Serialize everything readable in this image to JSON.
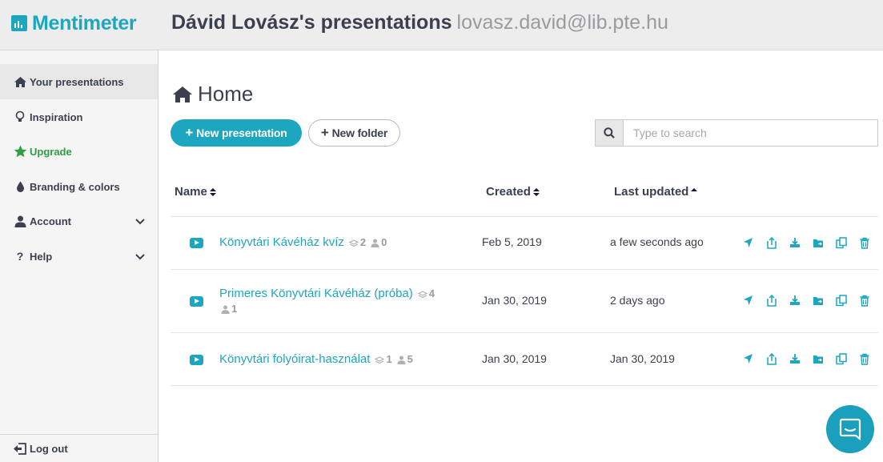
{
  "header": {
    "brand": "Mentimeter",
    "title": "Dávid Lovász's presentations",
    "email": "lovasz.david@lib.pte.hu"
  },
  "sidebar": {
    "items": [
      {
        "label": "Your presentations",
        "icon": "home-icon",
        "active": true
      },
      {
        "label": "Inspiration",
        "icon": "lightbulb-icon"
      },
      {
        "label": "Upgrade",
        "icon": "star-icon",
        "color": "#2f9e44"
      },
      {
        "label": "Branding & colors",
        "icon": "droplet-icon"
      },
      {
        "label": "Account",
        "icon": "user-icon",
        "expandable": true
      },
      {
        "label": "Help",
        "icon": "question-icon",
        "expandable": true
      }
    ],
    "logout": "Log out"
  },
  "main": {
    "title": "Home",
    "new_presentation": "New presentation",
    "new_folder": "New folder",
    "search_placeholder": "Type to search",
    "columns": {
      "name": "Name",
      "created": "Created",
      "last_updated": "Last updated"
    },
    "rows": [
      {
        "name": "Könyvtári Kávéház kvíz",
        "slides": "2",
        "participants": "0",
        "created": "Feb 5, 2019",
        "updated": "a few seconds ago"
      },
      {
        "name": "Primeres Könyvtári Kávéház (próba)",
        "slides": "4",
        "participants": "1",
        "created": "Jan 30, 2019",
        "updated": "2 days ago"
      },
      {
        "name": "Könyvtári folyóirat-használat",
        "slides": "1",
        "participants": "5",
        "created": "Jan 30, 2019",
        "updated": "Jan 30, 2019"
      }
    ],
    "row_actions": [
      "present-icon",
      "share-icon",
      "download-icon",
      "move-icon",
      "duplicate-icon",
      "delete-icon"
    ]
  },
  "colors": {
    "accent": "#1da6c0",
    "upgrade": "#2f9e44",
    "text": "#3b3f4f"
  }
}
